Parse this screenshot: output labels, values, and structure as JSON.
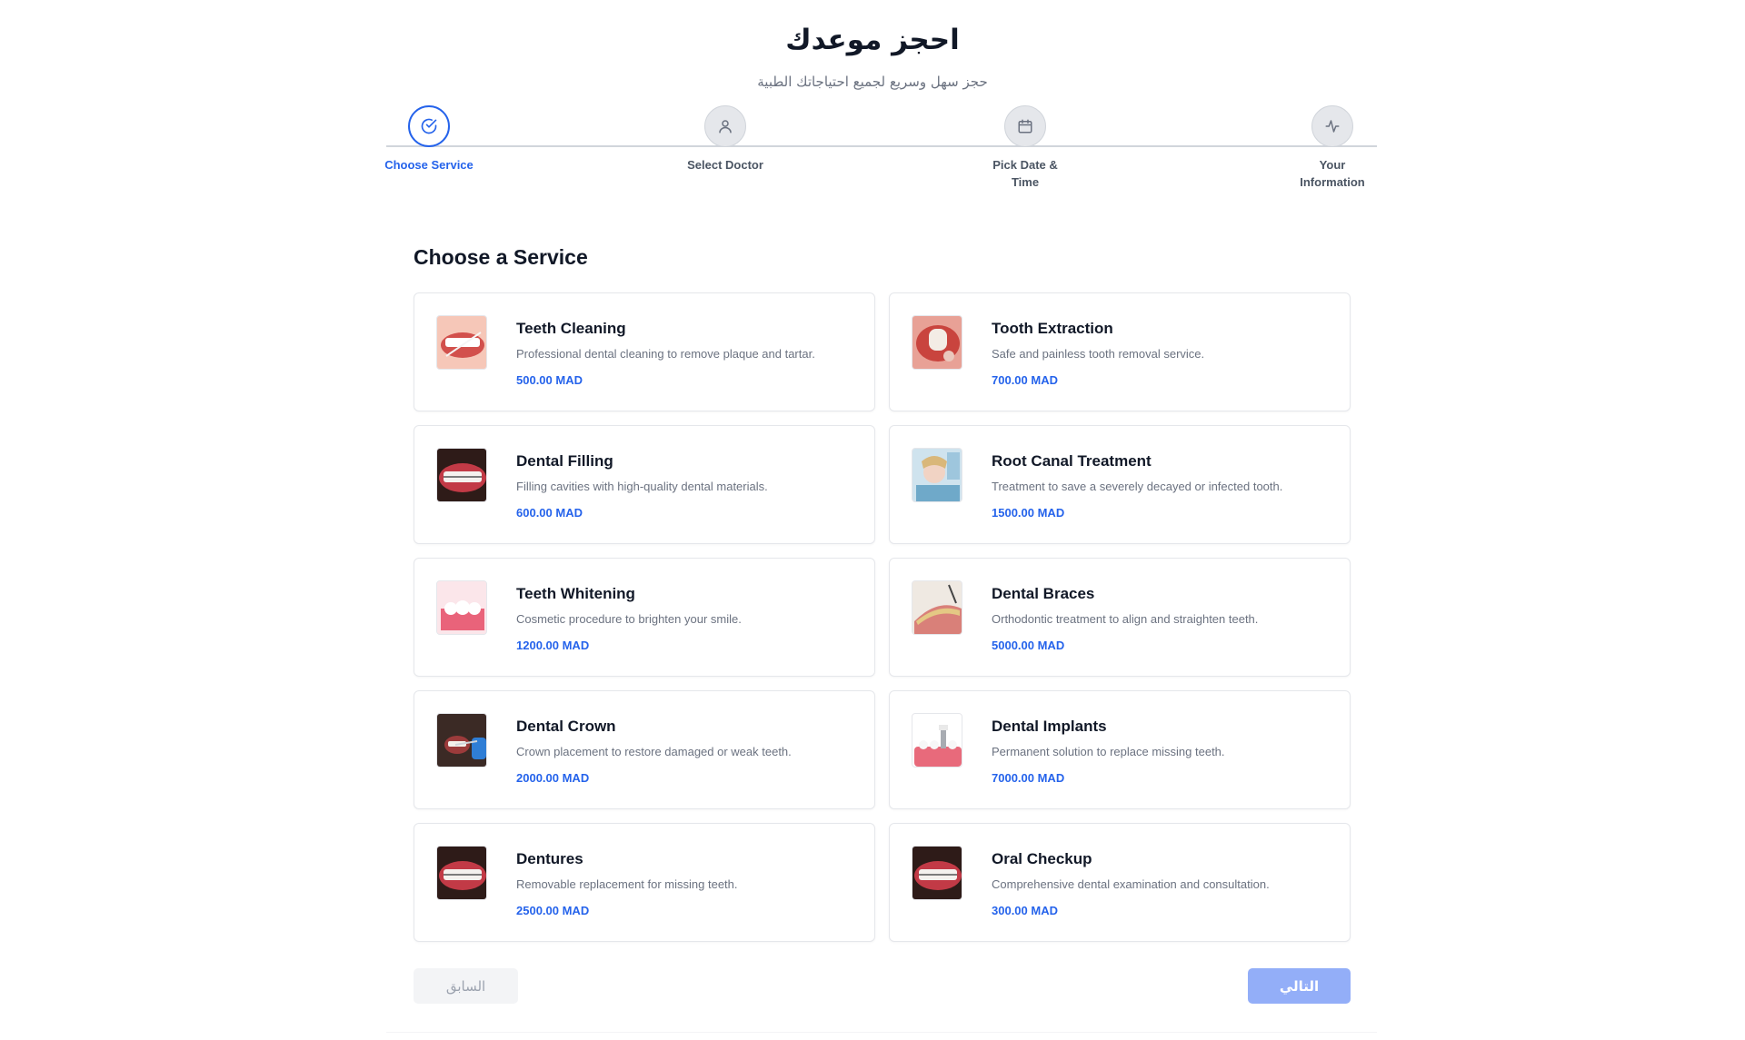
{
  "header": {
    "title": "احجز موعدك",
    "subtitle": "حجز سهل وسريع لجميع احتياجاتك الطبية"
  },
  "steps": [
    {
      "label": "Choose Service",
      "icon": "check-circle-icon",
      "active": true
    },
    {
      "label": "Select Doctor",
      "icon": "user-icon",
      "active": false
    },
    {
      "label": "Pick Date & Time",
      "icon": "calendar-icon",
      "active": false
    },
    {
      "label": "Your Information",
      "icon": "activity-icon",
      "active": false
    }
  ],
  "section_title": "Choose a Service",
  "services": [
    {
      "title": "Teeth Cleaning",
      "desc": "Professional dental cleaning to remove plaque and tartar.",
      "price": "500.00 MAD"
    },
    {
      "title": "Tooth Extraction",
      "desc": "Safe and painless tooth removal service.",
      "price": "700.00 MAD"
    },
    {
      "title": "Dental Filling",
      "desc": "Filling cavities with high-quality dental materials.",
      "price": "600.00 MAD"
    },
    {
      "title": "Root Canal Treatment",
      "desc": "Treatment to save a severely decayed or infected tooth.",
      "price": "1500.00 MAD"
    },
    {
      "title": "Teeth Whitening",
      "desc": "Cosmetic procedure to brighten your smile.",
      "price": "1200.00 MAD"
    },
    {
      "title": "Dental Braces",
      "desc": "Orthodontic treatment to align and straighten teeth.",
      "price": "5000.00 MAD"
    },
    {
      "title": "Dental Crown",
      "desc": "Crown placement to restore damaged or weak teeth.",
      "price": "2000.00 MAD"
    },
    {
      "title": "Dental Implants",
      "desc": "Permanent solution to replace missing teeth.",
      "price": "7000.00 MAD"
    },
    {
      "title": "Dentures",
      "desc": "Removable replacement for missing teeth.",
      "price": "2500.00 MAD"
    },
    {
      "title": "Oral Checkup",
      "desc": "Comprehensive dental examination and consultation.",
      "price": "300.00 MAD"
    }
  ],
  "buttons": {
    "prev": "السابق",
    "next": "التالي"
  },
  "colors": {
    "accent": "#2563eb",
    "next_button": "#93aef8",
    "price": "#2563eb"
  }
}
